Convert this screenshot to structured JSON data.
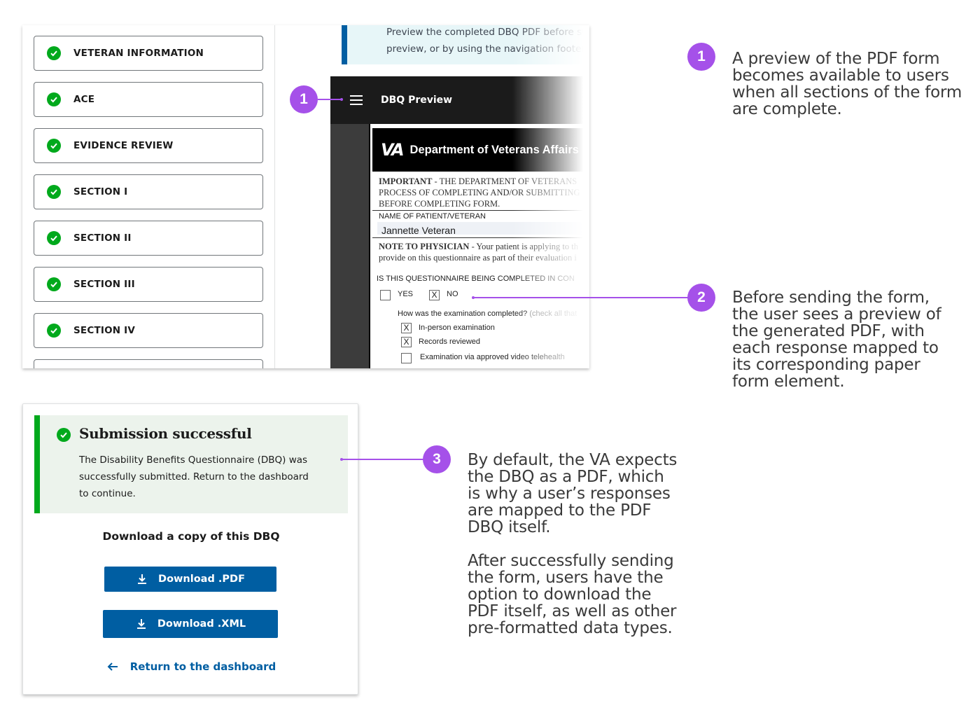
{
  "preview_screen": {
    "nav_items": [
      {
        "label": "VETERAN INFORMATION",
        "status_icon": "check-circle-icon"
      },
      {
        "label": "ACE",
        "status_icon": "check-circle-icon"
      },
      {
        "label": "EVIDENCE REVIEW",
        "status_icon": "check-circle-icon"
      },
      {
        "label": "SECTION I",
        "status_icon": "check-circle-icon"
      },
      {
        "label": "SECTION II",
        "status_icon": "check-circle-icon"
      },
      {
        "label": "SECTION III",
        "status_icon": "check-circle-icon"
      },
      {
        "label": "SECTION IV",
        "status_icon": "check-circle-icon"
      }
    ],
    "info_alert": {
      "line1": "Preview the completed DBQ PDF before su",
      "line2": "preview, or by using the navigation footer."
    },
    "pdf_toolbar": {
      "menu_icon": "hamburger-menu-icon",
      "title": "DBQ Preview"
    },
    "pdf": {
      "logo": "VA",
      "department": "Department of Veterans Affairs",
      "important_bold": "IMPORTANT",
      "important_rest": " - THE DEPARTMENT OF VETERANS",
      "important_line2": "PROCESS OF COMPLETING AND/OR SUBMITTING",
      "important_line3": "BEFORE COMPLETING FORM.",
      "name_label": "NAME OF PATIENT/VETERAN",
      "name_value": "Jannette Veteran",
      "note_bold": "NOTE TO PHYSICIAN",
      "note_rest": " - Your patient is applying to th",
      "note_line2": "provide on this questionnaire as part of their evaluation i",
      "question": "IS THIS QUESTIONNAIRE BEING COMPLETED IN CON",
      "yes_label": "YES",
      "no_label": "NO",
      "no_mark": "X",
      "exam_question": "How was the examination completed?",
      "exam_hint": " (check all that",
      "exam_options": [
        {
          "label": "In-person examination",
          "mark": "X"
        },
        {
          "label": "Records reviewed",
          "mark": "X"
        },
        {
          "label": "Examination via approved video telehealth",
          "mark": ""
        }
      ]
    }
  },
  "callouts": [
    {
      "number": "1",
      "text": "A preview of the PDF form becomes available to users when all sections of the form are complete."
    },
    {
      "number": "2",
      "text": "Before sending the form, the user sees a preview of the generated PDF, with each response mapped to its corresponding paper form element."
    },
    {
      "number": "3",
      "text": "By default, the VA expects the DBQ as a PDF, which is why a user’s responses are mapped to the PDF DBQ itself.",
      "text2": "After successfully sending the form, users have the option to download the PDF itself, as well as other pre-formatted data types."
    }
  ],
  "submission_screen": {
    "alert_heading": "Submission successful",
    "alert_body": "The Disability Benefits Questionnaire (DBQ) was successfully submitted. Return to the dashboard to continue.",
    "download_heading": "Download a copy of this DBQ",
    "download_pdf_label": "Download .PDF",
    "download_xml_label": "Download .XML",
    "return_label": "Return to the dashboard"
  },
  "colors": {
    "callout_accent": "#a551e9",
    "success_green": "#00a91c",
    "primary_blue": "#005ea2",
    "info_border": "#005ea2"
  }
}
